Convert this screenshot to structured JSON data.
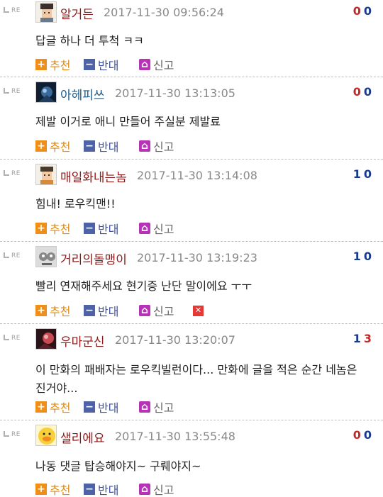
{
  "re_label": "RE",
  "actions": {
    "recommend": "추천",
    "oppose": "반대",
    "report": "신고",
    "delete": "✕"
  },
  "comments": [
    {
      "nick": "알거든",
      "date": "2017-11-30 09:56:24",
      "up": "0",
      "down": "0",
      "text": "답글 하나 더 투척 ㅋㅋ",
      "avatar": "pixel-avatar-icon"
    },
    {
      "nick": "아헤피쓰",
      "date": "2017-11-30 13:13:05",
      "up": "0",
      "down": "0",
      "text": "제발 이거로 애니 만들어 주실분 제발료",
      "avatar": "dark-photo-avatar-icon"
    },
    {
      "nick": "매일화내는놈",
      "date": "2017-11-30 13:14:08",
      "up": "1",
      "down": "0",
      "text": "힘내! 로우킥맨!!",
      "avatar": "pixel-avatar-icon"
    },
    {
      "nick": "거리의돌맹이",
      "date": "2017-11-30 13:19:23",
      "up": "1",
      "down": "0",
      "text": "빨리 연재해주세요 현기증 난단 말이에요 ㅜㅜ",
      "avatar": "gray-face-avatar-icon"
    },
    {
      "nick": "우마군신",
      "date": "2017-11-30 13:20:07",
      "up": "1",
      "down": "3",
      "text": "이 만화의 패배자는 로우킥빌런이다... 만화에 글을 적은 순간 네놈은 진거야...",
      "avatar": "red-photo-avatar-icon"
    },
    {
      "nick": "샐리에요",
      "date": "2017-11-30 13:55:48",
      "up": "0",
      "down": "0",
      "text": "나동 댓글 탑승해야지~ 구뤠야지~",
      "avatar": "duck-avatar-icon"
    }
  ]
}
